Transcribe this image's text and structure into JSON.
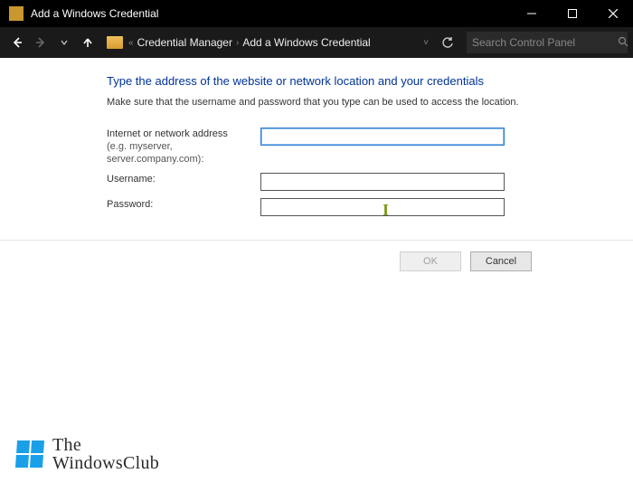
{
  "window": {
    "title": "Add a Windows Credential"
  },
  "breadcrumb": {
    "item1": "Credential Manager",
    "item2": "Add a Windows Credential"
  },
  "search": {
    "placeholder": "Search Control Panel"
  },
  "page": {
    "headline": "Type the address of the website or network location and your credentials",
    "subtext": "Make sure that the username and password that you type can be used to access the location."
  },
  "form": {
    "address": {
      "label": "Internet or network address",
      "hint": "(e.g. myserver, server.company.com):",
      "value": ""
    },
    "username": {
      "label": "Username:",
      "value": ""
    },
    "password": {
      "label": "Password:",
      "value": ""
    }
  },
  "buttons": {
    "ok": "OK",
    "cancel": "Cancel"
  },
  "watermark": {
    "line1": "The",
    "line2": "WindowsClub"
  }
}
